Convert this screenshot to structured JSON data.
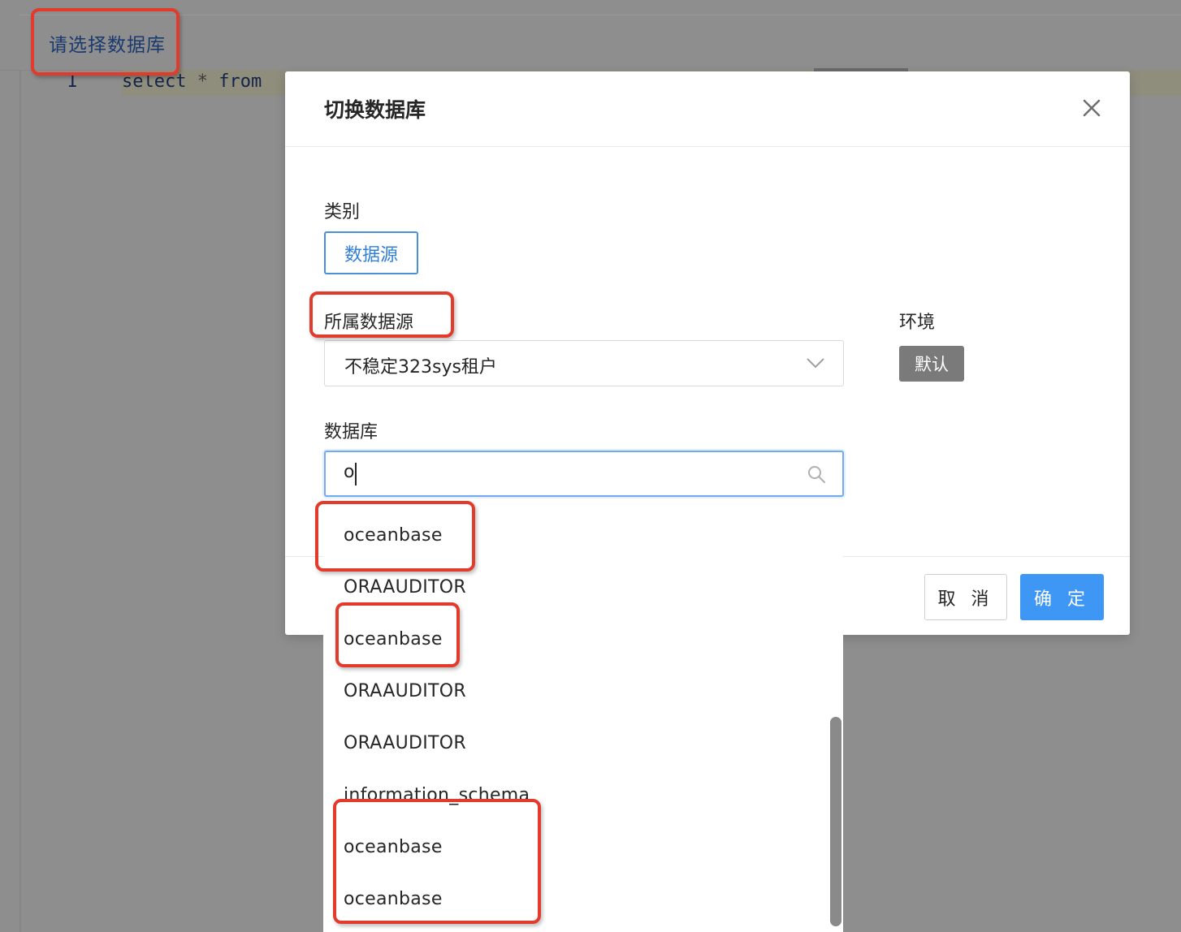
{
  "editor": {
    "db_select_link": "请选择数据库",
    "line_number": "1",
    "code_keyword_select": "select",
    "code_op": "*",
    "code_keyword_from": "from"
  },
  "modal": {
    "title": "切换数据库",
    "category_label": "类别",
    "category_value": "数据源",
    "datasource_label": "所属数据源",
    "datasource_value": "不稳定323sys租户",
    "env_label": "环境",
    "env_value": "默认",
    "database_label": "数据库",
    "database_search_value": "o",
    "cancel_label": "取 消",
    "ok_label": "确 定"
  },
  "dropdown": {
    "options": [
      "oceanbase",
      "ORAAUDITOR",
      "oceanbase",
      "ORAAUDITOR",
      "ORAAUDITOR",
      "information_schema",
      "oceanbase",
      "oceanbase"
    ]
  },
  "colors": {
    "accent": "#3f97f5",
    "annotation": "#e23a2b",
    "env_badge": "#7a7a7a"
  },
  "icons": [
    "close-icon",
    "chevron-down-icon",
    "search-icon"
  ]
}
